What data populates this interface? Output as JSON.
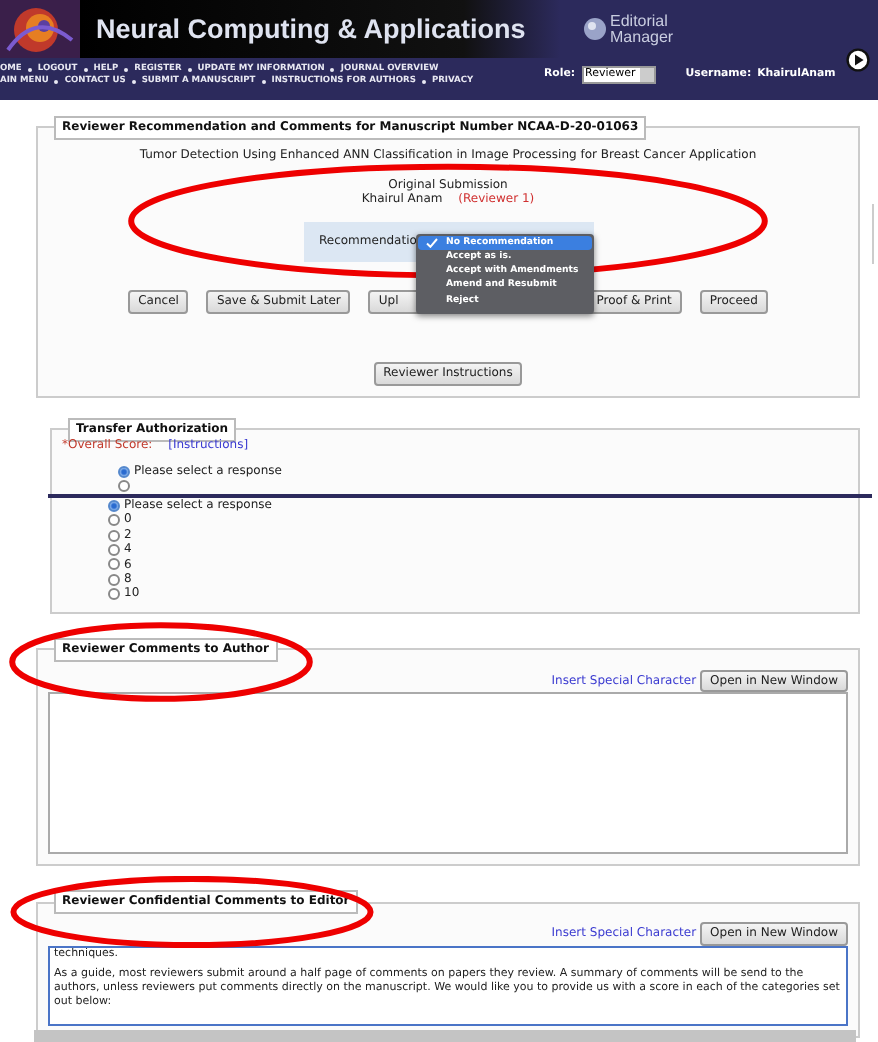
{
  "header": {
    "journal_title": "Neural Computing & Applications",
    "logo_text": [
      "Editorial",
      "Manager"
    ],
    "nav_rows": [
      [
        "OME",
        "LOGOUT",
        "HELP",
        "REGISTER",
        "UPDATE MY INFORMATION",
        "JOURNAL OVERVIEW"
      ],
      [
        "AIN MENU",
        "CONTACT US",
        "SUBMIT A MANUSCRIPT",
        "INSTRUCTIONS FOR AUTHORS",
        "PRIVACY"
      ]
    ],
    "role_label": "Role:",
    "role_value": "Reviewer",
    "username_label": "Username:",
    "username": "KhairulAnam"
  },
  "recommendation_section": {
    "legend": "Reviewer Recommendation and Comments for Manuscript Number NCAA-D-20-01063",
    "circled": true,
    "manuscript_title": "Tumor Detection Using Enhanced ANN Classification in Image Processing for Breast Cancer Application",
    "submission": "Original Submission",
    "reviewer_name": "Khairul Anam",
    "reviewer_role": "(Reviewer 1)",
    "recommendation": {
      "label": "Recommendatio",
      "expanded": true,
      "options": [
        {
          "label": "No Recommendation",
          "selected": true
        },
        {
          "label": "Accept as is.",
          "selected": false
        },
        {
          "label": "Accept with Amendments",
          "selected": false
        },
        {
          "label": "Amend and Resubmit",
          "selected": false
        },
        {
          "label": "Reject",
          "selected": false
        }
      ]
    },
    "buttons": [
      "Cancel",
      "Save & Submit Later",
      "Upl",
      "Proof & Print",
      "Proceed"
    ],
    "instructions_button": "Reviewer Instructions"
  },
  "transfer_section": {
    "legend": "Transfer Authorization",
    "score_label": "*Overall Score:",
    "instructions_link": "[Instructions]",
    "radio_groups": [
      [
        {
          "label": "Please select a response",
          "selected": true
        },
        {
          "selected": false
        }
      ],
      [
        {
          "label": "Please select a response",
          "selected": true
        },
        {
          "label": "0",
          "selected": false
        },
        {
          "label": "2",
          "selected": false
        },
        {
          "label": "4",
          "selected": false
        },
        {
          "label": "6",
          "selected": false
        },
        {
          "label": "8",
          "selected": false
        },
        {
          "label": "10",
          "selected": false
        }
      ]
    ]
  },
  "comment_sections": [
    {
      "legend": "Reviewer Comments to Author",
      "circled": true,
      "insert_link": "Insert Special Character",
      "window_button": "Open in New Window"
    },
    {
      "legend": "Reviewer Confidential Comments to Editor",
      "circled": true,
      "insert_link": "Insert Special Character",
      "window_button": "Open in New Window",
      "text_lines": [
        "techniques.",
        "As a guide, most reviewers submit around a half page of comments on papers they review. A summary of comments will be send to the authors, unless reviewers put comments directly on the manuscript. We would like you to provide us with a score in each of the categories set out below:"
      ]
    }
  ]
}
